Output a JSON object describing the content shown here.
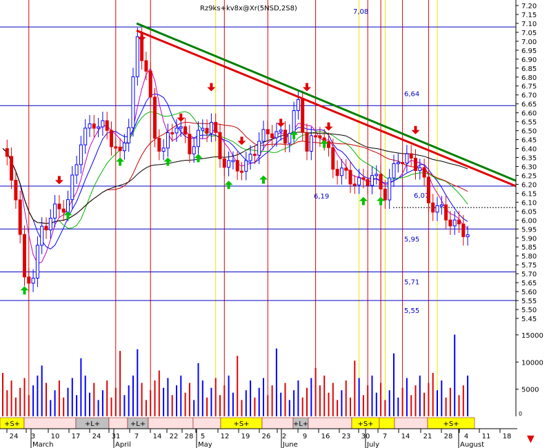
{
  "header": {
    "overlay_text": "Rz9ks+kv8x@Xr(5NSD,2S8)"
  },
  "chart_data": {
    "type": "candlestick",
    "price_axis": {
      "ylim": [
        5.45,
        7.2
      ],
      "ticks": [
        "7.20",
        "7.15",
        "7.10",
        "7.05",
        "7.00",
        "6.95",
        "6.90",
        "6.85",
        "6.80",
        "6.75",
        "6.70",
        "6.65",
        "6.60",
        "6.55",
        "6.50",
        "6.45",
        "6.40",
        "6.35",
        "6.30",
        "6.25",
        "6.20",
        "6.15",
        "6.10",
        "6.05",
        "6.00",
        "5.95",
        "5.90",
        "5.85",
        "5.80",
        "5.75",
        "5.70",
        "5.65",
        "5.60",
        "5.55",
        "5.50",
        "5.45"
      ]
    },
    "volume_axis": {
      "ylim": [
        0,
        16000
      ],
      "ticks": [
        "15000",
        "10000",
        "5000"
      ],
      "zero_label": "0"
    },
    "x_axis": {
      "day_labels": [
        "24",
        "3",
        "10",
        "17",
        "24",
        "31",
        "7",
        "14",
        "22",
        "28",
        "5",
        "12",
        "19",
        "26",
        "2",
        "9",
        "16",
        "23",
        "30",
        "7",
        "14",
        "21",
        "28",
        "4",
        "11",
        "18"
      ],
      "month_labels": [
        "March",
        "April",
        "May",
        "June",
        "July",
        "August"
      ]
    },
    "horizontal_levels": [
      {
        "value": 7.08,
        "label": "7,08"
      },
      {
        "value": 6.64,
        "label": "6,64"
      },
      {
        "value": 6.19,
        "label": "6,19"
      },
      {
        "value": 6.07,
        "label": "6,07"
      },
      {
        "value": 5.95,
        "label": "5,95"
      },
      {
        "value": 5.71,
        "label": "5,71"
      },
      {
        "value": 5.55,
        "label": "5,55"
      }
    ],
    "trendlines": [
      {
        "name": "",
        "color": "#008000",
        "from": [
          7,
          7.1
        ],
        "to": [
          81,
          6.22
        ]
      },
      {
        "name": "",
        "color": "#e00000",
        "from": [
          7,
          7.06
        ],
        "to": [
          81,
          6.19
        ]
      }
    ],
    "strip_labels": [
      "+S+",
      "+L+",
      "+L+",
      "+S+",
      "+L+",
      "+S+",
      "+S+"
    ],
    "colors": {
      "up": "#0000ff",
      "down": "#e00000",
      "level": "#0000c0",
      "sell_arrow": "#e00000",
      "buy_arrow": "#00c000",
      "strip_yellow": "#ffff00",
      "strip_gray": "#c0c0c0"
    }
  }
}
